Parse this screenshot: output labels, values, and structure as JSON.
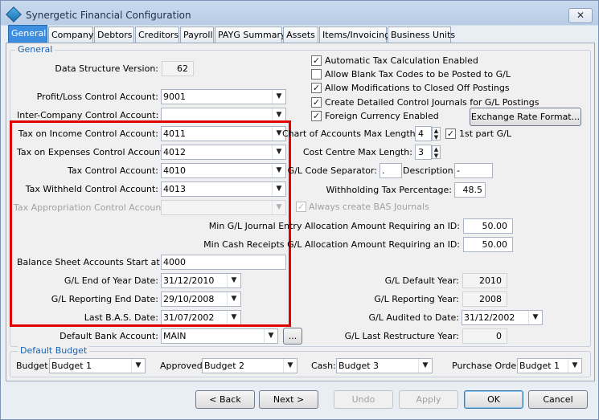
{
  "window": {
    "title": "Synergetic Financial Configuration",
    "close": "✕"
  },
  "tabs": [
    "General",
    "Company",
    "Debtors",
    "Creditors",
    "Payroll",
    "PAYG Summary",
    "Assets",
    "Items/Invoicing",
    "Business Units"
  ],
  "general": {
    "legend": "General",
    "data_structure_version_label": "Data Structure Version:",
    "data_structure_version": "62",
    "pl_control_label": "Profit/Loss Control Account:",
    "pl_control": "9001",
    "interco_control_label": "Inter-Company Control Account:",
    "interco_control": "",
    "tax_income_label": "Tax on Income Control Account:",
    "tax_income": "4011",
    "tax_expenses_label": "Tax on Expenses Control Account:",
    "tax_expenses": "4012",
    "tax_control_label": "Tax Control Account:",
    "tax_control": "4010",
    "tax_withheld_label": "Tax Withheld Control Account:",
    "tax_withheld": "4013",
    "tax_appropriation_label": "Tax Appropriation Control Account:",
    "tax_appropriation": "",
    "bs_start_label": "Balance Sheet Accounts Start at:",
    "bs_start": "4000",
    "eoy_date_label": "G/L End of Year Date:",
    "eoy_date": "31/12/2010",
    "reporting_end_label": "G/L Reporting End Date:",
    "reporting_end": "29/10/2008",
    "last_bas_label": "Last B.A.S. Date:",
    "last_bas": "31/07/2002",
    "default_bank_label": "Default Bank Account:",
    "default_bank": "MAIN",
    "ellipsis": "...",
    "auto_tax": "Automatic Tax Calculation Enabled",
    "allow_blank_tax": "Allow Blank Tax Codes to be Posted to G/L",
    "allow_mods": "Allow Modifications to Closed Off Postings",
    "detailed_journals": "Create Detailed Control Journals for G/L Postings",
    "foreign_currency": "Foreign Currency Enabled",
    "exchange_rate_btn": "Exchange Rate Format...",
    "coa_max_len_label": "Chart of Accounts Max Length:",
    "coa_max_len": "4",
    "first_part_gl": "1st part G/L",
    "cc_max_len_label": "Cost Centre Max Length:",
    "cc_max_len": "3",
    "gl_sep_label": "G/L Code Separator:",
    "gl_sep": ".",
    "description_label": "Description:",
    "description": "-",
    "withholding_label": "Withholding Tax Percentage:",
    "withholding": "48.5",
    "always_bas": "Always create BAS Journals",
    "min_gl_journal_label": "Min G/L Journal Entry Allocation Amount Requiring an ID:",
    "min_gl_journal": "50.00",
    "min_cash_label": "Min Cash Receipts G/L Allocation Amount Requiring an ID:",
    "min_cash": "50.00",
    "gl_default_year_label": "G/L Default Year:",
    "gl_default_year": "2010",
    "gl_reporting_year_label": "G/L Reporting Year:",
    "gl_reporting_year": "2008",
    "gl_audited_label": "G/L Audited to Date:",
    "gl_audited": "31/12/2002",
    "gl_last_restructure_label": "G/L Last Restructure Year:",
    "gl_last_restructure": "0"
  },
  "budget": {
    "legend": "Default Budget",
    "budget_label": "Budget:",
    "budget": "Budget 1",
    "approved_label": "Approved:",
    "approved": "Budget 2",
    "cash_label": "Cash:",
    "cash": "Budget 3",
    "po_label": "Purchase Order:",
    "po": "Budget 1"
  },
  "buttons": {
    "back": "< Back",
    "next": "Next >",
    "undo": "Undo",
    "apply": "Apply",
    "ok": "OK",
    "cancel": "Cancel"
  },
  "colors": {
    "highlight_box": "#e00000",
    "active_tab": "#3d8ee0",
    "legend_text": "#1a62b5"
  }
}
